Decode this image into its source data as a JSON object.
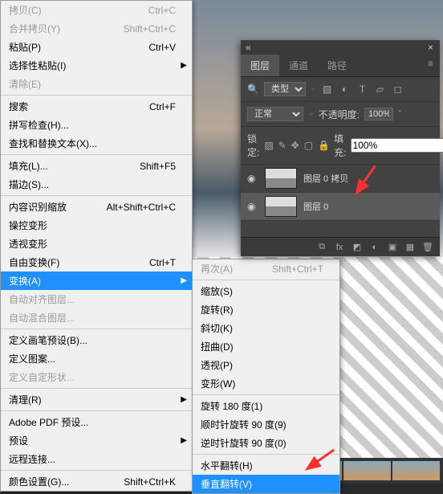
{
  "menu": {
    "copy": {
      "label": "拷贝(C)",
      "shortcut": "Ctrl+C"
    },
    "merge_copy": {
      "label": "合并拷贝(Y)",
      "shortcut": "Shift+Ctrl+C"
    },
    "paste": {
      "label": "粘贴(P)",
      "shortcut": "Ctrl+V"
    },
    "paste_special": {
      "label": "选择性粘贴(I)"
    },
    "clear": {
      "label": "清除(E)"
    },
    "search": {
      "label": "搜索",
      "shortcut": "Ctrl+F"
    },
    "spell": {
      "label": "拼写检查(H)..."
    },
    "find_replace": {
      "label": "查找和替换文本(X)..."
    },
    "fill": {
      "label": "填充(L)...",
      "shortcut": "Shift+F5"
    },
    "stroke": {
      "label": "描边(S)..."
    },
    "content_scale": {
      "label": "内容识别缩放",
      "shortcut": "Alt+Shift+Ctrl+C"
    },
    "puppet": {
      "label": "操控变形"
    },
    "perspective": {
      "label": "透视变形"
    },
    "free_trans": {
      "label": "自由变换(F)",
      "shortcut": "Ctrl+T"
    },
    "transform": {
      "label": "变换(A)"
    },
    "auto_align": {
      "label": "自动对齐图层..."
    },
    "auto_blend": {
      "label": "自动混合图层..."
    },
    "brush_preset": {
      "label": "定义画笔预设(B)..."
    },
    "pattern": {
      "label": "定义图案..."
    },
    "custom_shape": {
      "label": "定义自定形状..."
    },
    "purge": {
      "label": "清理(R)"
    },
    "adobe_pdf": {
      "label": "Adobe PDF 预设..."
    },
    "presets": {
      "label": "预设"
    },
    "remote": {
      "label": "远程连接..."
    },
    "color_settings": {
      "label": "颜色设置(G)...",
      "shortcut": "Shift+Ctrl+K"
    }
  },
  "submenu": {
    "again": {
      "label": "再次(A)",
      "shortcut": "Shift+Ctrl+T"
    },
    "scale": {
      "label": "缩放(S)"
    },
    "rotate": {
      "label": "旋转(R)"
    },
    "skew": {
      "label": "斜切(K)"
    },
    "distort": {
      "label": "扭曲(D)"
    },
    "persp": {
      "label": "透视(P)"
    },
    "warp": {
      "label": "变形(W)"
    },
    "r180": {
      "label": "旋转 180 度(1)"
    },
    "r90cw": {
      "label": "顺时针旋转 90 度(9)"
    },
    "r90ccw": {
      "label": "逆时针旋转 90 度(0)"
    },
    "fliph": {
      "label": "水平翻转(H)"
    },
    "flipv": {
      "label": "垂直翻转(V)"
    }
  },
  "panel": {
    "tabs": {
      "layers": "图层",
      "channels": "通道",
      "paths": "路径"
    },
    "filter_kind": "类型",
    "blend": {
      "mode": "正常",
      "opacity_label": "不透明度:",
      "opacity": "100%"
    },
    "lock": {
      "label": "锁定:",
      "fill_label": "填充:",
      "fill": "100%"
    },
    "layer1": "图层 0 拷贝",
    "layer2": "图层 0"
  }
}
